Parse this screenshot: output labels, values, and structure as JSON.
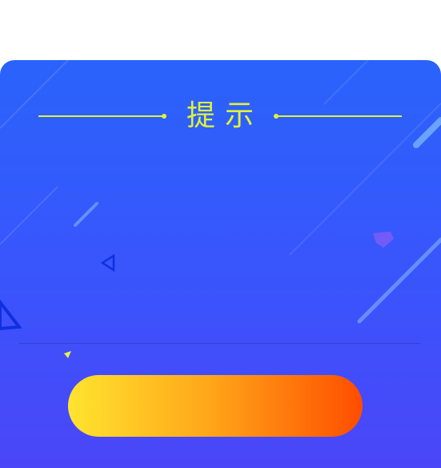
{
  "dialog": {
    "title": "提示",
    "message": "",
    "confirm_label": ""
  },
  "colors": {
    "accent": "#dff23a",
    "background_top": "#2a63fb",
    "background_bottom": "#4b46f8",
    "button_start": "#ffe42f",
    "button_end": "#ff4d00"
  }
}
